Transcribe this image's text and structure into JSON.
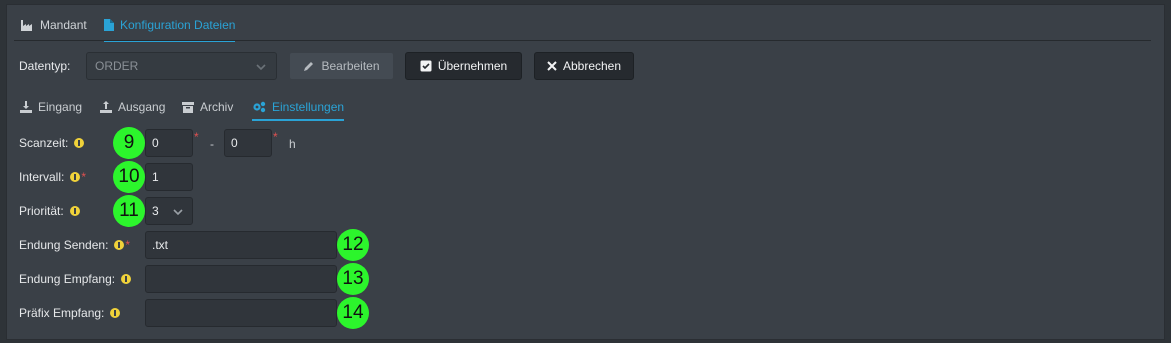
{
  "tabs": [
    {
      "label": "Mandant",
      "icon": "factory-icon"
    },
    {
      "label": "Konfiguration Dateien",
      "icon": "file-icon"
    }
  ],
  "toolbar": {
    "datatype_label": "Datentyp:",
    "datatype_value": "ORDER",
    "edit_label": "Bearbeiten",
    "apply_label": "Übernehmen",
    "cancel_label": "Abbrechen"
  },
  "subtabs": [
    {
      "label": "Eingang",
      "icon": "download-icon"
    },
    {
      "label": "Ausgang",
      "icon": "upload-icon"
    },
    {
      "label": "Archiv",
      "icon": "archive-icon"
    },
    {
      "label": "Einstellungen",
      "icon": "gears-icon"
    }
  ],
  "form": {
    "scan": {
      "label": "Scanzeit:",
      "from": "0",
      "separator": "-",
      "to": "0",
      "unit": "h"
    },
    "interval": {
      "label": "Intervall:",
      "value": "1"
    },
    "priority": {
      "label": "Priorität:",
      "value": "3"
    },
    "ext_send": {
      "label": "Endung Senden:",
      "value": ".txt"
    },
    "ext_receive": {
      "label": "Endung Empfang:",
      "value": ""
    },
    "prefix_receive": {
      "label": "Präfix Empfang:",
      "value": ""
    }
  },
  "required_marker": "*",
  "badges": [
    "9",
    "10",
    "11",
    "12",
    "13",
    "14"
  ],
  "colors": {
    "accent": "#2aa3d6",
    "badge": "#2cf52c",
    "info": "#f0d23a",
    "required": "#e05050"
  }
}
